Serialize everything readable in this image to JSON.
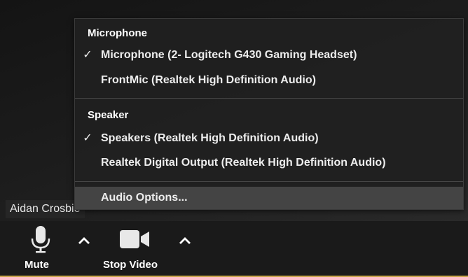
{
  "video": {
    "participant_name": "Aidan Crosbie"
  },
  "toolbar": {
    "mute_label": "Mute",
    "stop_video_label": "Stop Video"
  },
  "audio_menu": {
    "microphone_header": "Microphone",
    "microphone_items": [
      {
        "label": "Microphone (2- Logitech G430 Gaming Headset)",
        "checked": true,
        "check_glyph": "✓"
      },
      {
        "label": "FrontMic (Realtek High Definition Audio)",
        "checked": false,
        "check_glyph": ""
      }
    ],
    "speaker_header": "Speaker",
    "speaker_items": [
      {
        "label": "Speakers (Realtek High Definition Audio)",
        "checked": true,
        "check_glyph": "✓"
      },
      {
        "label": "Realtek Digital Output (Realtek High Definition Audio)",
        "checked": false,
        "check_glyph": ""
      }
    ],
    "options_label": "Audio Options..."
  }
}
